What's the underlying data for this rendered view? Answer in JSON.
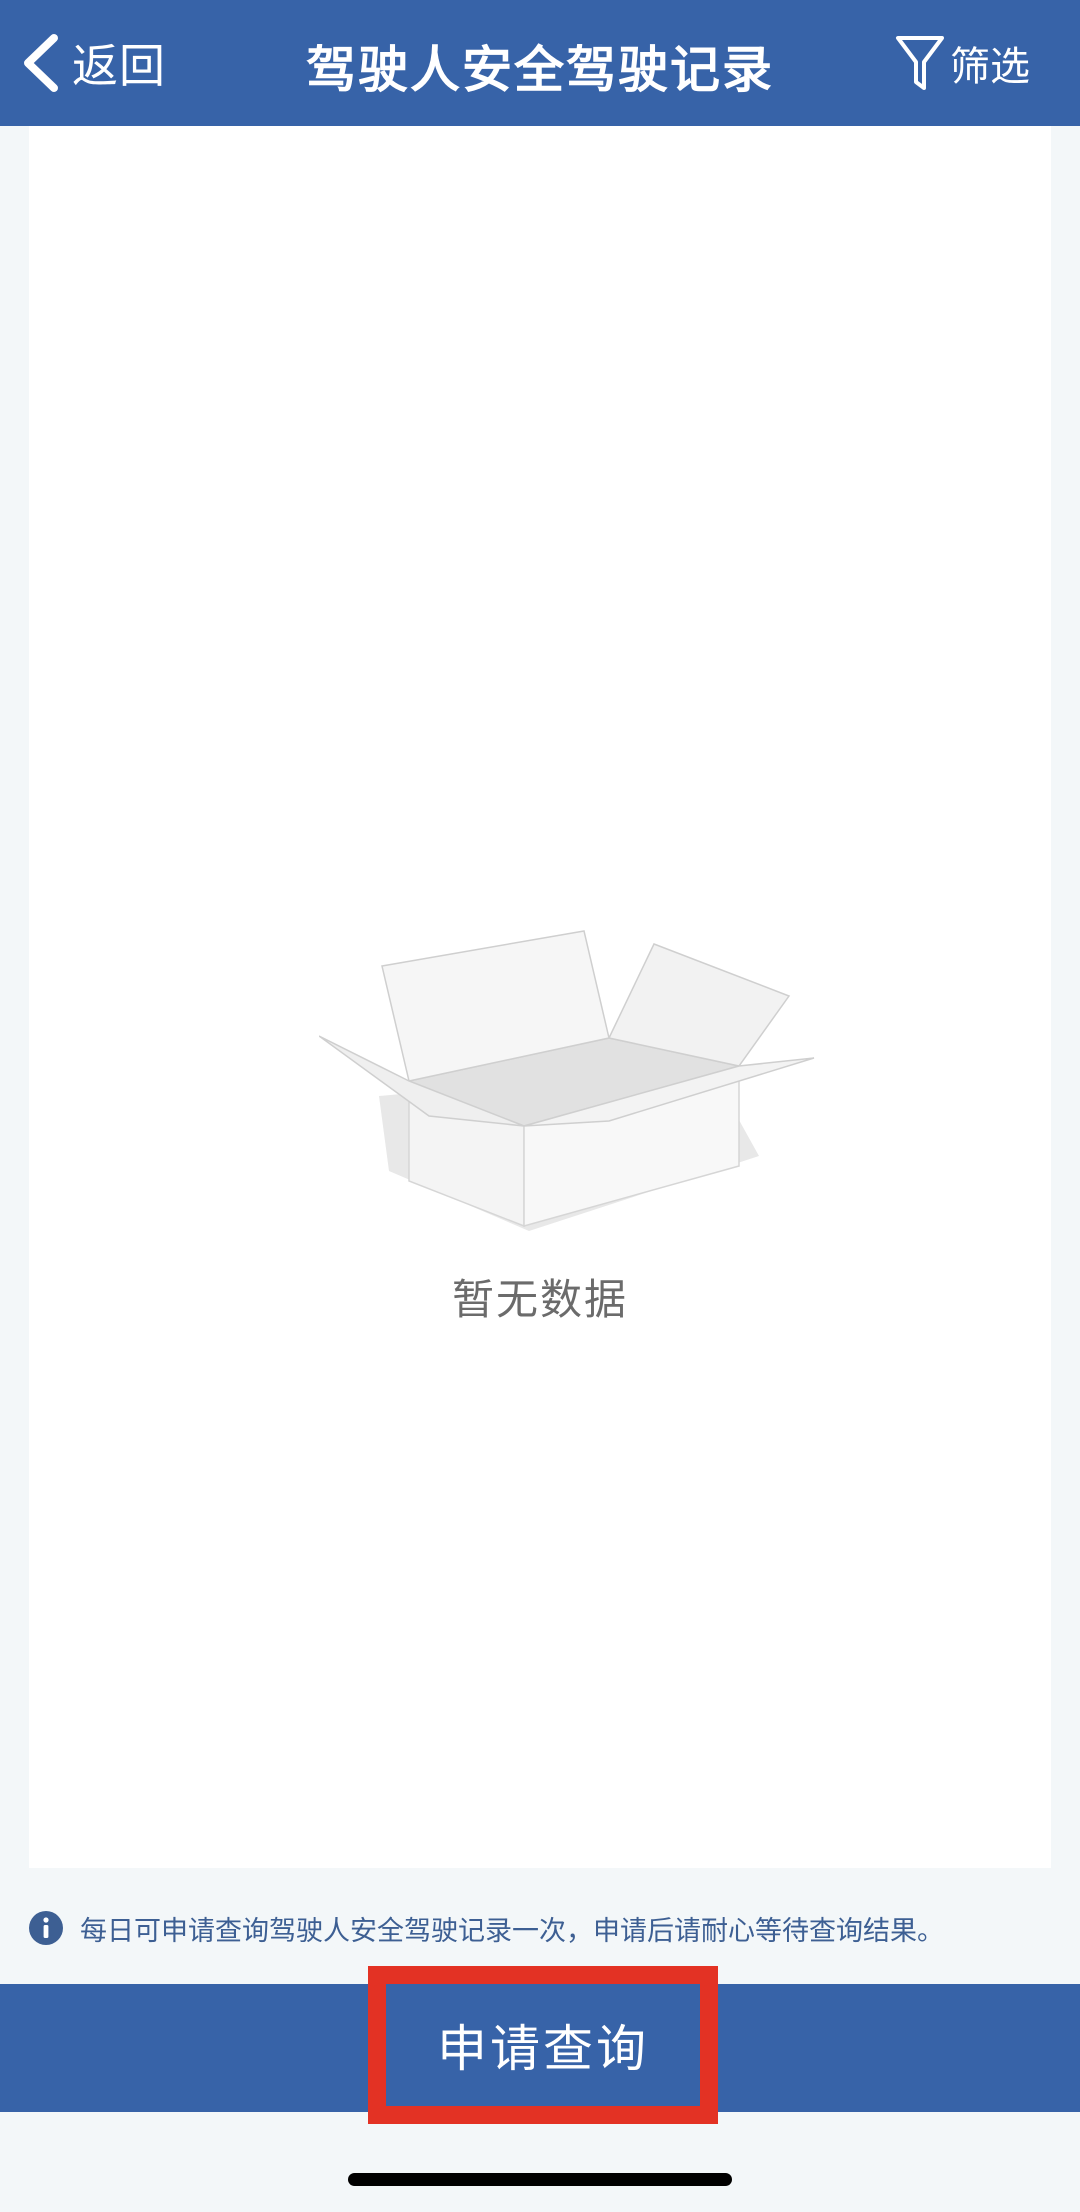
{
  "header": {
    "back_label": "返回",
    "title": "驾驶人安全驾驶记录",
    "filter_label": "筛选"
  },
  "empty_state": {
    "text": "暂无数据"
  },
  "notice": {
    "text": "每日可申请查询驾驶人安全驾驶记录一次，申请后请耐心等待查询结果。"
  },
  "actions": {
    "apply_label": "申请查询"
  },
  "colors": {
    "primary": "#3763a8",
    "background": "#f3f7f9",
    "highlight": "#e33224"
  },
  "icons": [
    "chevron-left-icon",
    "filter-funnel-icon",
    "empty-box-icon",
    "info-icon"
  ]
}
